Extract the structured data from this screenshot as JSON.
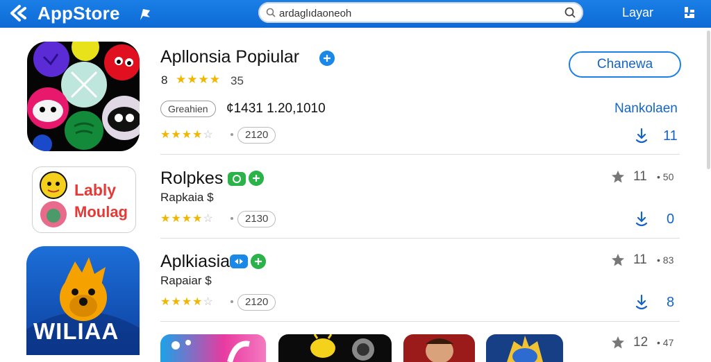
{
  "header": {
    "brand": "AppStore",
    "search_value": "ardaglıdaoneoh",
    "right_link": "Layar"
  },
  "featured": {
    "title": "Apllonsia Popiular",
    "rank": "8",
    "rating_count": "35",
    "category_pill": "Greahien",
    "price_text": "¢1431 1.20,1010",
    "rating_pill": "2120",
    "open_button": "Chanewa",
    "side_link": "Nankolaen",
    "download_count": "11"
  },
  "apps": [
    {
      "title": "Rolpkes",
      "subtitle": "Rapkaia $",
      "rating_pill": "2130",
      "meta_value": "11",
      "meta_extra": "• 50",
      "download_count": "0",
      "icon_text_1": "Lably",
      "icon_text_2": "Moulag"
    },
    {
      "title": "Aplkiasia",
      "subtitle": "Rapaiar $",
      "rating_pill": "2120",
      "meta_value": "11",
      "meta_extra": "• 83",
      "download_count": "8",
      "icon_text_1": "WILIAA"
    }
  ],
  "bottom_row": {
    "meta_value": "12",
    "meta_extra": "• 47"
  },
  "colors": {
    "accent": "#1a7fe6",
    "star": "#f2b600",
    "verified_blue": "#1a88e8",
    "verified_green": "#2bb34a"
  },
  "icons": [
    "back-icon",
    "flag-icon",
    "search-icon",
    "grid-icon",
    "star-icon",
    "download-icon",
    "verified-icon",
    "check-icon"
  ]
}
